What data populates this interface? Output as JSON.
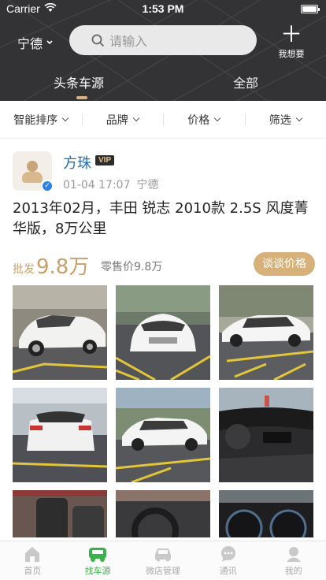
{
  "status_bar": {
    "carrier": "Carrier",
    "time": "1:53 PM"
  },
  "header": {
    "city": "宁德",
    "search_placeholder": "请输入",
    "want_label": "我想要",
    "tabs": [
      {
        "label": "头条车源"
      },
      {
        "label": "全部"
      }
    ]
  },
  "filters": [
    {
      "label": "智能排序"
    },
    {
      "label": "品牌"
    },
    {
      "label": "价格"
    },
    {
      "label": "筛选"
    }
  ],
  "post": {
    "user_name": "方珠",
    "vip_badge": "VIP",
    "date": "01-04 17:07",
    "location": "宁德",
    "title": "2013年02月，丰田 锐志 2010款 2.5S 风度菁华版，8万公里",
    "wholesale_label": "批发",
    "wholesale_price": "9.8万",
    "retail_price": "零售价9.8万",
    "talk_button": "谈谈价格"
  },
  "tabbar": [
    {
      "label": "首页",
      "icon": "home-icon"
    },
    {
      "label": "找车源",
      "icon": "find-car-icon"
    },
    {
      "label": "微店管理",
      "icon": "car-shop-icon"
    },
    {
      "label": "通讯",
      "icon": "chat-icon"
    },
    {
      "label": "我的",
      "icon": "user-icon"
    }
  ],
  "colors": {
    "header_bg": "#333336",
    "accent_gold": "#d6b27a",
    "active_green": "#3bb14a",
    "name_blue": "#1f6fb5"
  }
}
